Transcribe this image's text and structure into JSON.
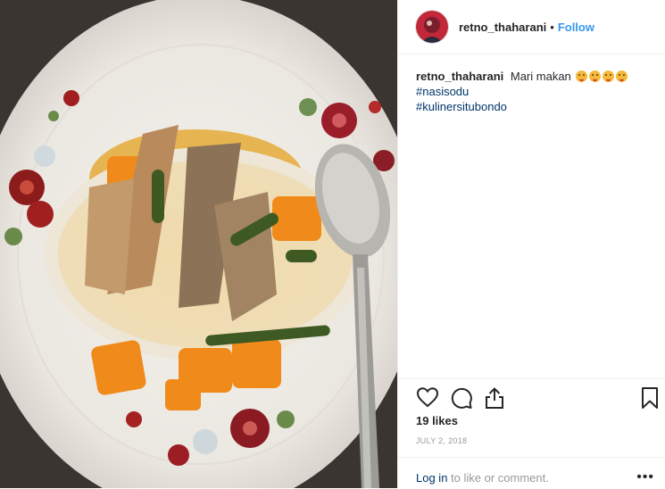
{
  "post": {
    "username": "retno_thaharani",
    "separator": "•",
    "follow_label": "Follow",
    "caption_text": "Mari makan",
    "caption_emoji": [
      "face-savoring-food-emoji",
      "face-savoring-food-emoji",
      "face-savoring-food-emoji",
      "face-savoring-food-emoji"
    ],
    "hashtags": [
      "#nasisodu",
      "#kulinersitubondo"
    ],
    "likes": "19 likes",
    "date": "JULY 2, 2018",
    "login_link": "Log in",
    "login_rest": " to like or comment.",
    "more": "•••"
  },
  "icons": [
    "heart-icon",
    "comment-icon",
    "share-icon",
    "bookmark-icon",
    "more-icon"
  ],
  "colors": {
    "link": "#3897f0",
    "hashtag": "#003569",
    "muted": "#999999",
    "text": "#262626"
  }
}
